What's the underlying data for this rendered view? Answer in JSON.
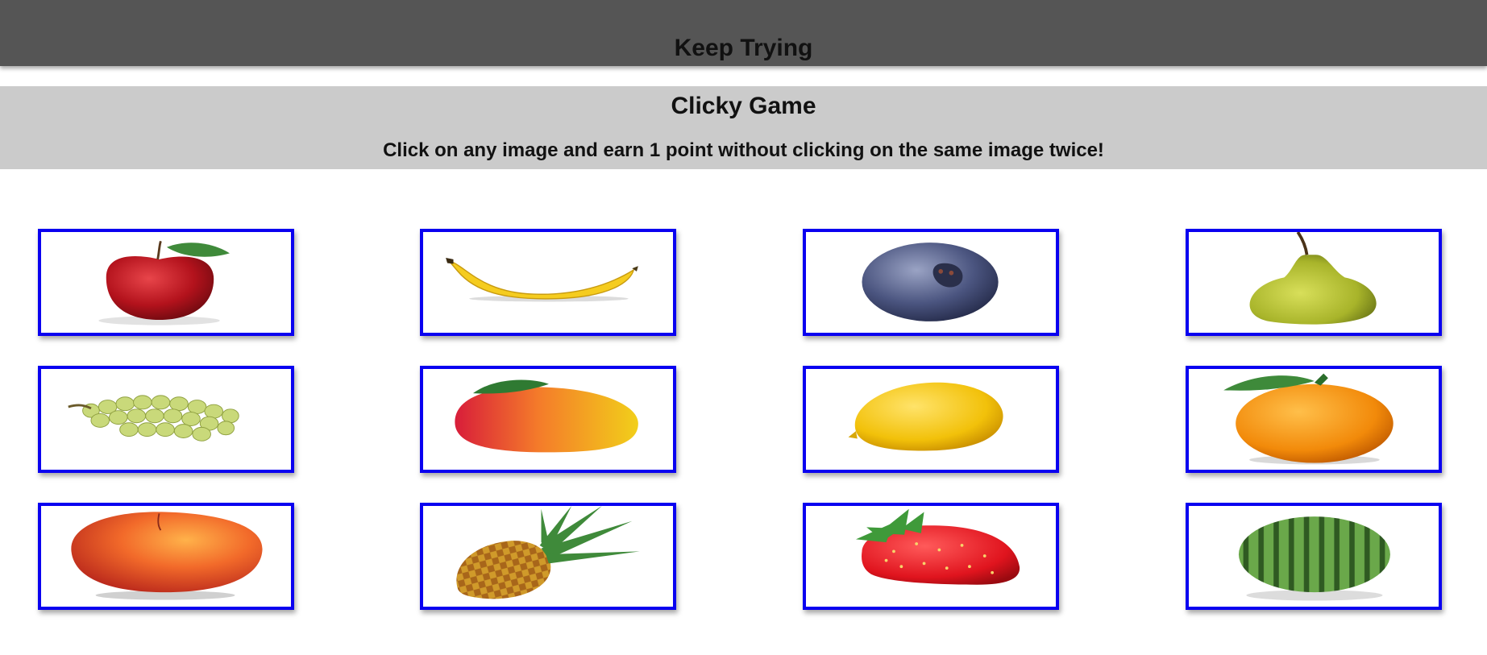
{
  "header": {
    "status_message": "Keep Trying"
  },
  "banner": {
    "title": "Clicky Game",
    "instructions": "Click on any image and earn 1 point without clicking on the same image twice!"
  },
  "colors": {
    "card_border": "#0a00f0",
    "topbar": "#555555",
    "banner": "#cbcbcb"
  },
  "cards": [
    {
      "fruit": "apple"
    },
    {
      "fruit": "banana"
    },
    {
      "fruit": "blueberry"
    },
    {
      "fruit": "pear"
    },
    {
      "fruit": "grapes"
    },
    {
      "fruit": "mango"
    },
    {
      "fruit": "lemon"
    },
    {
      "fruit": "orange"
    },
    {
      "fruit": "peach"
    },
    {
      "fruit": "pineapple"
    },
    {
      "fruit": "strawberry"
    },
    {
      "fruit": "watermelon"
    }
  ]
}
